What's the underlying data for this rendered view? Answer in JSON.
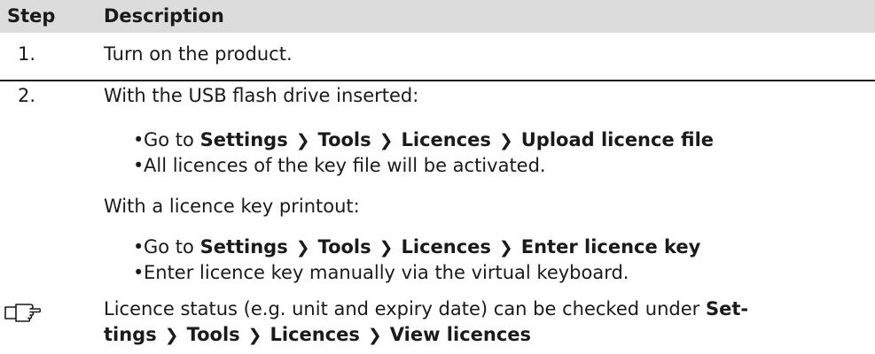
{
  "header": {
    "col_step": "Step",
    "col_description": "Description"
  },
  "rows": [
    {
      "step": "1.",
      "text": "Turn on the product."
    },
    {
      "step": "2.",
      "intro1": "With the USB flash drive inserted:",
      "bullets1": [
        {
          "prefix": "Go to",
          "path": [
            "Settings",
            "Tools",
            "Licences",
            "Upload licence file"
          ]
        },
        {
          "text": "All licences of the key file will be activated."
        }
      ],
      "intro2": "With a licence key printout:",
      "bullets2": [
        {
          "prefix": "Go to",
          "path": [
            "Settings",
            "Tools",
            "Licences",
            "Enter licence key"
          ]
        },
        {
          "text": "Enter licence key manually via the virtual keyboard."
        }
      ]
    }
  ],
  "note": {
    "line1_text": "Licence status (e.g. unit and expiry date) can be checked under",
    "line1_bold": "Set-",
    "line2_path": [
      "tings",
      "Tools",
      "Licences",
      "View licences"
    ]
  },
  "separator": "❯",
  "bullet_char": "•",
  "icon": "hand-pointing-icon"
}
